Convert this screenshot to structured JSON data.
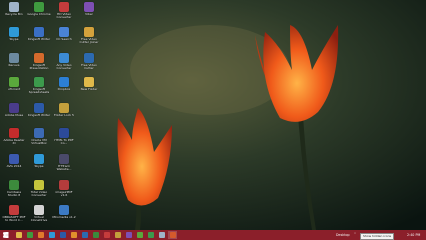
{
  "desktop": {
    "icons": [
      {
        "name": "recycle-bin-icon",
        "label": "Recycle Bin",
        "color": "#9fb3c8"
      },
      {
        "name": "google-chrome-icon",
        "label": "Google Chrome",
        "color": "#3f9a3f"
      },
      {
        "name": "hd-video-converter-icon",
        "label": "HD Video Converter",
        "color": "#c43c3c"
      },
      {
        "name": "viber-icon",
        "label": "Viber",
        "color": "#7d4fb3"
      },
      {
        "name": "skype-icon",
        "label": "Skype",
        "color": "#2f9ad8"
      },
      {
        "name": "kingsoft-writer-icon",
        "label": "Kingsoft Writer",
        "color": "#3a6fc4"
      },
      {
        "name": "cc-search-icon",
        "label": "CC Search",
        "color": "#4a83d6"
      },
      {
        "name": "free-video-cutter-icon",
        "label": "Free Video Cutter Joiner",
        "color": "#d4a23c"
      },
      {
        "name": "recuva-icon",
        "label": "Recuva",
        "color": "#6c8aa0"
      },
      {
        "name": "kingsoft-presentation-icon",
        "label": "Kingsoft Presentation",
        "color": "#d46a2c"
      },
      {
        "name": "any-video-converter-icon",
        "label": "Any Video Converter",
        "color": "#3c8bd4"
      },
      {
        "name": "free-video-cutter-2-icon",
        "label": "Free Video Cutter",
        "color": "#2c6ab0"
      },
      {
        "name": "utorrent-icon",
        "label": "uTorrent",
        "color": "#5aa83c"
      },
      {
        "name": "kingsoft-spreadsheets-icon",
        "label": "Kingsoft Spreadsheets",
        "color": "#3c9a4c"
      },
      {
        "name": "dropbox-icon",
        "label": "Dropbox",
        "color": "#2c7fd4"
      },
      {
        "name": "new-folder-icon",
        "label": "New Folder",
        "color": "#e0b94a"
      },
      {
        "name": "adobe-muse-icon",
        "label": "Adobe Muse",
        "color": "#4a3c8a"
      },
      {
        "name": "kingsoft-writer-2-icon",
        "label": "Kingsoft Writer",
        "color": "#2c5aa8"
      },
      {
        "name": "folder-lock-icon",
        "label": "Folder Lock 5",
        "color": "#c4a03c"
      },
      {
        "name": "adobe-reader-icon",
        "label": "Adobe Reader XI",
        "color": "#c42c2c"
      },
      {
        "name": "oracle-virtualbox-icon",
        "label": "Oracle VM VirtualBox",
        "color": "#3c6ab4"
      },
      {
        "name": "html-to-pdf-icon",
        "label": "HTML To PDF Co...",
        "color": "#2c4a9a"
      },
      {
        "name": "avg-icon",
        "label": "AVG 2014",
        "color": "#3c5ab0"
      },
      {
        "name": "skype-2-icon",
        "label": "Skype",
        "color": "#2f9ad8"
      },
      {
        "name": "httrack-icon",
        "label": "HTTrack Website...",
        "color": "#4a4a6a"
      },
      {
        "name": "camtasia-icon",
        "label": "Camtasia Studio 8",
        "color": "#3c8a3c"
      },
      {
        "name": "total-video-converter-icon",
        "label": "Total Video Converter",
        "color": "#c4c43c"
      },
      {
        "name": "image2pdf-icon",
        "label": "image2PDF v1.6",
        "color": "#b43c3c"
      },
      {
        "name": "obrasoft-pdf-icon",
        "label": "OBRASOFT PDF to Word C...",
        "color": "#c43c3c"
      },
      {
        "name": "virtual-clonedrive-icon",
        "label": "Virtual CloneDrive",
        "color": "#d4d4d4"
      },
      {
        "name": "mcomedia-icon",
        "label": "MComedia v1.2",
        "color": "#3c7ac4"
      }
    ]
  },
  "taskbar": {
    "apps": [
      {
        "name": "taskbar-file-explorer-icon",
        "color": "#e0b94a"
      },
      {
        "name": "taskbar-chrome-icon",
        "color": "#3f9a3f"
      },
      {
        "name": "taskbar-firefox-icon",
        "color": "#e07a2c"
      },
      {
        "name": "taskbar-skype-icon",
        "color": "#2f9ad8"
      },
      {
        "name": "taskbar-word-icon",
        "color": "#2c5aa8"
      },
      {
        "name": "taskbar-media-player-icon",
        "color": "#e0902c"
      },
      {
        "name": "taskbar-photoshop-icon",
        "color": "#2c6ab0"
      },
      {
        "name": "taskbar-camtasia-icon",
        "color": "#3c8a3c"
      },
      {
        "name": "taskbar-video-icon",
        "color": "#c43c3c"
      },
      {
        "name": "taskbar-folder-icon",
        "color": "#c4a03c"
      },
      {
        "name": "taskbar-app-icon",
        "color": "#7d4fb3"
      },
      {
        "name": "taskbar-utorrent-icon",
        "color": "#5aa83c"
      },
      {
        "name": "taskbar-excel-icon",
        "color": "#3c9a4c"
      },
      {
        "name": "taskbar-misc-icon",
        "color": "#9fb3c8"
      },
      {
        "name": "taskbar-active-app-icon",
        "color": "#d45a2c"
      }
    ],
    "desktop_label": "Desktop",
    "tooltip": "Show hidden icons",
    "clock": "2:40 PM"
  },
  "colors": {
    "taskbar_bg": "#8b1f2a",
    "flower": "#e8521f"
  }
}
